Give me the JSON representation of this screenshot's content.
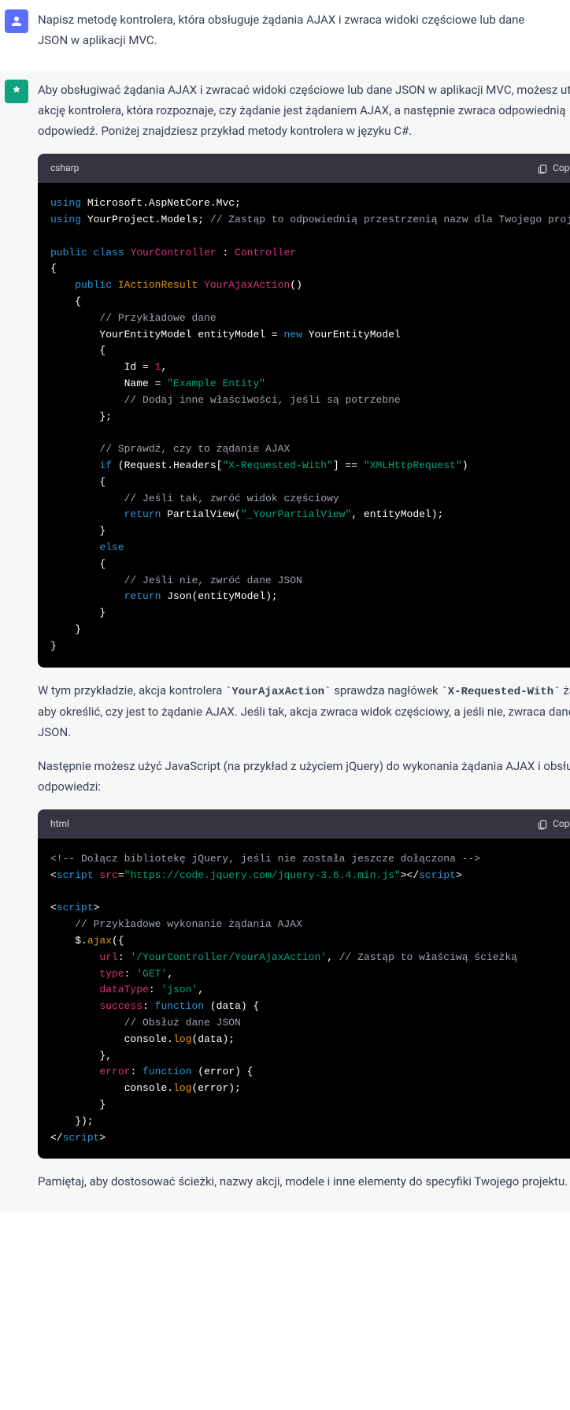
{
  "user_message": "Napisz metodę kontrolera, która obsługuje żądania AJAX i zwraca widoki częściowe lub dane JSON w aplikacji MVC.",
  "assistant_intro": "Aby obsługiwać żądania AJAX i zwracać widoki częściowe lub dane JSON w aplikacji MVC, możesz utworzyć akcję kontrolera, która rozpoznaje, czy żądanie jest żądaniem AJAX, a następnie zwraca odpowiednią odpowiedź. Poniżej znajdziesz przykład metody kontrolera w języku C#.",
  "code1_lang": "csharp",
  "copy_label": "Copy code",
  "para2_pre": "W tym przykładzie, akcja kontrolera ",
  "para2_code1": "YourAjaxAction",
  "para2_mid": " sprawdza nagłówek ",
  "para2_code2": "X-Requested-With",
  "para2_post": " żądania, aby określić, czy jest to żądanie AJAX. Jeśli tak, akcja zwraca widok częściowy, a jeśli nie, zwraca dane JSON.",
  "para3": "Następnie możesz użyć JavaScript (na przykład z użyciem jQuery) do wykonania żądania AJAX i obsługi odpowiedzi:",
  "code2_lang": "html",
  "para4": "Pamiętaj, aby dostosować ścieżki, nazwy akcji, modele i inne elementy do specyfiki Twojego projektu.",
  "csharp": {
    "using": "using",
    "ns1": "Microsoft.AspNetCore.Mvc",
    "ns2": "YourProject.Models",
    "cmt_ns": "// Zastąp to odpowiednią przestrzenią nazw dla Twojego projektu",
    "public": "public",
    "class": "class",
    "controller_name": "YourController",
    "base_class": "Controller",
    "return_type": "IActionResult",
    "action_name": "YourAjaxAction",
    "cmt_data": "// Przykładowe dane",
    "model_type": "YourEntityModel",
    "var_name": "entityModel",
    "new": "new",
    "id": "Id",
    "one": "1",
    "name": "Name",
    "name_val": "\"Example Entity\"",
    "cmt_props": "// Dodaj inne właściwości, jeśli są potrzebne",
    "cmt_check": "// Sprawdź, czy to żądanie AJAX",
    "if": "if",
    "header_key": "\"X-Requested-With\"",
    "header_val": "\"XMLHttpRequest\"",
    "cmt_partial": "// Jeśli tak, zwróć widok częściowy",
    "return": "return",
    "partial_view": "\"_YourPartialView\"",
    "else": "else",
    "cmt_json": "// Jeśli nie, zwróć dane JSON"
  },
  "html_code": {
    "cmt_jquery": "<!-- Dołącz bibliotekę jQuery, jeśli nie została jeszcze dołączona -->",
    "script": "script",
    "src": "src",
    "jquery_url": "\"https://code.jquery.com/jquery-3.6.4.min.js\"",
    "cmt_ajax": "// Przykładowe wykonanie żądania AJAX",
    "ajax": "ajax",
    "url": "url",
    "url_val": "'/YourController/YourAjaxAction'",
    "url_cmt": "// Zastąp to właściwą ścieżką",
    "type": "type",
    "get": "'GET'",
    "dataType": "dataType",
    "json": "'json'",
    "success": "success",
    "function": "function",
    "cmt_handle": "// Obsłuż dane JSON",
    "console": "console",
    "log": "log",
    "error": "error"
  }
}
